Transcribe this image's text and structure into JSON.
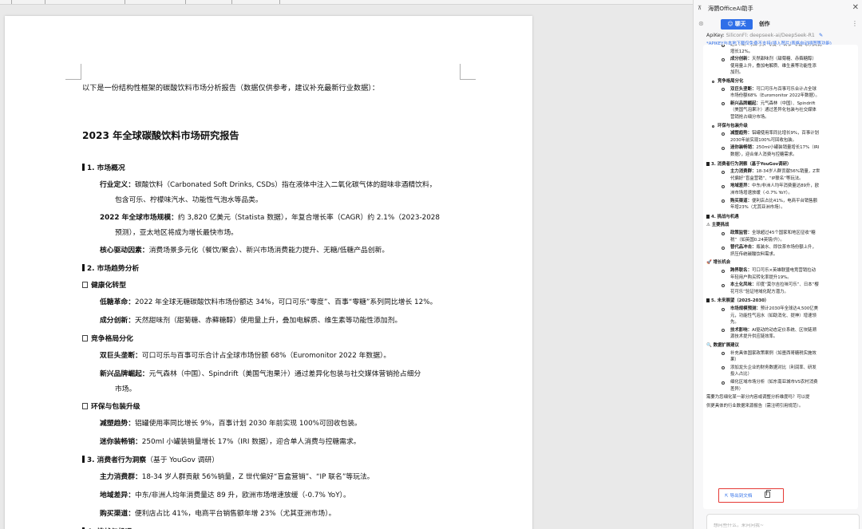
{
  "document": {
    "intro": "以下是一份结构性框架的碳酸饮料市场分析报告（数据仅供参考，建议补充最新行业数据）：",
    "title": "2023 年全球碳酸饮料市场研究报告",
    "lines": [
      {
        "kind": "h2",
        "text": "1. 市场概况"
      },
      {
        "kind": "p",
        "lead": "行业定义：",
        "text": "碳酸饮料（Carbonated Soft Drinks, CSDs）指在液体中注入二氧化碳气体的甜味非酒精饮料，"
      },
      {
        "kind": "pc",
        "text": "包含可乐、柠檬味汽水、功能性气泡水等品类。"
      },
      {
        "kind": "p",
        "lead": "2022 年全球市场规模：",
        "text": "约 3,820 亿美元（Statista 数据），年复合增长率（CAGR）约 2.1%（2023-2028"
      },
      {
        "kind": "pc",
        "text": "预测），亚太地区将成为增长最快市场。"
      },
      {
        "kind": "p",
        "lead": "核心驱动因素：",
        "text": "消费场景多元化（餐饮/聚会）、新兴市场消费能力提升、无糖/低糖产品创新。"
      },
      {
        "kind": "h2",
        "text": "2. 市场趋势分析"
      },
      {
        "kind": "h3",
        "text": "健康化转型"
      },
      {
        "kind": "p",
        "lead": "低糖革命：",
        "text": "2022 年全球无糖碳酸饮料市场份额达 34%，可口可乐“零度”、百事“零糖”系列同比增长 12%。"
      },
      {
        "kind": "p",
        "lead": "成分创新：",
        "text": "天然甜味剂（甜菊糖、赤藓糖醇）使用量上升，叠加电解质、维生素等功能性添加剂。"
      },
      {
        "kind": "h3",
        "text": "竞争格局分化"
      },
      {
        "kind": "p",
        "lead": "双巨头垄断：",
        "text": "可口可乐与百事可乐合计占全球市场份额 68%（Euromonitor 2022 年数据）。"
      },
      {
        "kind": "p",
        "lead": "新兴品牌崛起：",
        "text": "元气森林（中国）、Spindrift（美国气泡果汁）通过差异化包装与社交媒体营销抢占细分"
      },
      {
        "kind": "pc",
        "text": "市场。"
      },
      {
        "kind": "h3",
        "text": "环保与包装升级"
      },
      {
        "kind": "p",
        "lead": "减塑趋势：",
        "text": "铝罐使用率同比增长 9%，百事计划 2030 年前实现 100%可回收包装。"
      },
      {
        "kind": "p",
        "lead": "迷你装畅销：",
        "text": "250ml 小罐装销量增长 17%（IRI 数据），迎合单人消费与控糖需求。"
      },
      {
        "kind": "h2",
        "text": "3. 消费者行为洞察",
        "tail": "（基于 YouGov 调研）"
      },
      {
        "kind": "p",
        "lead": "主力消费群：",
        "text": "18-34 岁人群贡献 56%销量，Z 世代偏好“盲盒营销”、“IP 联名”等玩法。"
      },
      {
        "kind": "p",
        "lead": "地域差异：",
        "text": "中东/非洲人均年消费量达 89 升，欧洲市场增速放缓（-0.7% YoY）。"
      },
      {
        "kind": "p",
        "lead": "购买渠道：",
        "text": "便利店占比 41%，电商平台销售额年增 23%（尤其亚洲市场）。"
      },
      {
        "kind": "h2",
        "text": "4. 挑战与机遇"
      },
      {
        "kind": "h3",
        "text": "主要挑战"
      }
    ]
  },
  "panel": {
    "title": "海鹦OfficeAI助手",
    "tab_chat": "聊天",
    "tab_create": "创作",
    "apikey_label": "ApiKey",
    "apikey_value": "SiliconFl: deepseek-ai/DeepSeek-R1",
    "apikey_note": "*APIKEY与本地下载仅免费不支持(插入图片/表格自动插图等功能)",
    "chat_lines": [
      {
        "t": "b2",
        "text": "达34%。可口可乐“零度”、百事“零糖”系列同比"
      },
      {
        "t": "c2",
        "text": "增长12%。"
      },
      {
        "t": "b2",
        "lead": "成分创新：",
        "text": "天然甜味剂（甜菊糖、赤藓糖醇）"
      },
      {
        "t": "c2",
        "text": "使用量上升，叠加电解质、维生素等功能性添"
      },
      {
        "t": "c2",
        "text": "加剂。"
      },
      {
        "t": "b1",
        "text": "竞争格局分化"
      },
      {
        "t": "b2",
        "lead": "双巨头垄断：",
        "text": "可口可乐与百事可乐合计占全球"
      },
      {
        "t": "c2",
        "text": "市场份额68%（Euromonitor 2022年数据）。"
      },
      {
        "t": "b2",
        "lead": "新兴品牌崛起：",
        "text": "元气森林（中国）、Spindrift"
      },
      {
        "t": "c2",
        "text": "（美国气泡果汁）通过差异化包装与社交媒体"
      },
      {
        "t": "c2",
        "text": "营销抢占细分市场。"
      },
      {
        "t": "b1",
        "text": "环保与包装升级"
      },
      {
        "t": "b2",
        "lead": "减塑趋势：",
        "text": "铝罐使用率同比增长9%，百事计划"
      },
      {
        "t": "c2",
        "text": "2030年前实现100%可回收包装。"
      },
      {
        "t": "b2",
        "lead": "迷你装畅销：",
        "text": "250ml小罐装销量增长17%（IRI"
      },
      {
        "t": "c2",
        "text": "数据），迎合单人消费与控糖需求。"
      },
      {
        "t": "h",
        "text": "3. 消费者行为洞察（基于YouGov调研）"
      },
      {
        "t": "b2",
        "lead": "主力消费群：",
        "text": "18-34岁人群贡献56%销量，Z世"
      },
      {
        "t": "c2",
        "text": "代偏好“盲盒营销”、“IP联名”等玩法。"
      },
      {
        "t": "b2",
        "lead": "地域差异：",
        "text": "中东/非洲人均年消费量达89升，欧"
      },
      {
        "t": "c2",
        "text": "洲市场增速放缓（-0.7% YoY）。"
      },
      {
        "t": "b2",
        "lead": "购买渠道：",
        "text": "便利店占比41%，电商平台销售额"
      },
      {
        "t": "c2",
        "text": "年增23%（尤其亚洲市场）。"
      },
      {
        "t": "h",
        "text": "4. 挑战与机遇"
      },
      {
        "t": "s",
        "text": "⚠ 主要挑战"
      },
      {
        "t": "b2",
        "lead": "政策监管：",
        "text": "全球超过45个国家和地区征收“糖"
      },
      {
        "t": "c2",
        "text": "税”（如英国0.24英镑/升）。"
      },
      {
        "t": "b2",
        "lead": "替代品冲击：",
        "text": "瓶装水、即饮茶市场份额上升，"
      },
      {
        "t": "c2",
        "text": "挤压传统碳酸饮料需求。"
      },
      {
        "t": "s",
        "text": "🚀 增长机会"
      },
      {
        "t": "b2",
        "lead": "跨界联名：",
        "text": "可口可乐×英雄联盟电竞营销拉动"
      },
      {
        "t": "c2",
        "text": "年轻用户购买转化率提升19%。"
      },
      {
        "t": "b2",
        "lead": "本土化风味：",
        "text": "印度“莫尔吉拉味可乐”、日本“樱"
      },
      {
        "t": "c2",
        "text": "花可乐”验证地域化配方潜力。"
      },
      {
        "t": "h",
        "text": "5. 未来展望（2025-2030）"
      },
      {
        "t": "b2",
        "lead": "市场规模预测：",
        "text": "预计2030年全球达4,500亿美"
      },
      {
        "t": "c2",
        "text": "元，功能性气泡水（如助消化、提神）增速领"
      },
      {
        "t": "c2",
        "text": "先。"
      },
      {
        "t": "b2",
        "lead": "技术影响：",
        "text": "AI驱动的动态定价系统、区块链溯"
      },
      {
        "t": "c2",
        "text": "源技术提升供应链效率。"
      },
      {
        "t": "s",
        "text": "🔍 数据扩展建议"
      },
      {
        "t": "b2",
        "text": "补充具体国家政策案例（如墨西哥糖税实施效"
      },
      {
        "t": "c2",
        "text": "果）"
      },
      {
        "t": "b2",
        "text": "添加龙头企业的财务数据对比（利润率、研发"
      },
      {
        "t": "c2",
        "text": "投入占比）"
      },
      {
        "t": "b2",
        "text": "细化区域市场分析（如东南亚城市VS农村消费"
      },
      {
        "t": "c2",
        "text": "差异）"
      },
      {
        "t": "p",
        "text": "需要为您细化某一部分内容或调整分析维度吗？可以提"
      },
      {
        "t": "p",
        "text": "供更具体的行业数据来源报告（需注明引用规范）。"
      }
    ],
    "export_label": "导出到文档",
    "input_placeholder": "想问些什么，来问问我~"
  }
}
